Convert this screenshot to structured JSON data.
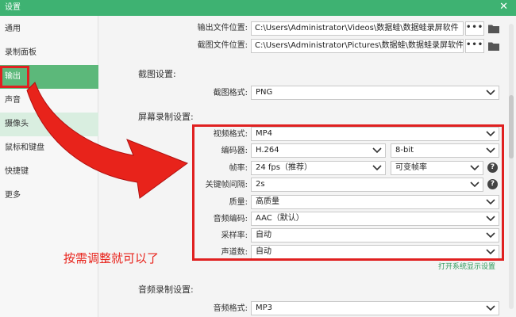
{
  "window": {
    "title": "设置",
    "close_glyph": "✕"
  },
  "sidebar": {
    "items": [
      {
        "label": "通用",
        "state": "normal"
      },
      {
        "label": "录制面板",
        "state": "normal"
      },
      {
        "label": "输出",
        "state": "active"
      },
      {
        "label": "声音",
        "state": "normal"
      },
      {
        "label": "摄像头",
        "state": "hover"
      },
      {
        "label": "鼠标和键盘",
        "state": "normal"
      },
      {
        "label": "快捷键",
        "state": "normal"
      },
      {
        "label": "更多",
        "state": "normal"
      }
    ]
  },
  "output": {
    "output_folder_label": "输出文件位置:",
    "output_folder_value": "C:\\Users\\Administrator\\Videos\\数据蛙\\数据蛙录屏软件",
    "screenshot_folder_label": "截图文件位置:",
    "screenshot_folder_value": "C:\\Users\\Administrator\\Pictures\\数据蛙\\数据蛙录屏软件",
    "browse_label": "•••"
  },
  "screenshot_settings": {
    "section_title": "截图设置:",
    "format_label": "截图格式:",
    "format_value": "PNG"
  },
  "screen_recording": {
    "section_title": "屏幕录制设置:",
    "video_format_label": "视频格式:",
    "video_format_value": "MP4",
    "encoder_label": "编码器:",
    "encoder_value": "H.264",
    "bit_depth_value": "8-bit",
    "framerate_label": "帧率:",
    "framerate_value": "24 fps（推荐）",
    "framerate_mode_value": "可变帧率",
    "keyframe_label": "关键帧间隔:",
    "keyframe_value": "2s",
    "quality_label": "质量:",
    "quality_value": "高质量",
    "audio_codec_label": "音频编码:",
    "audio_codec_value": "AAC（默认）",
    "sample_rate_label": "采样率:",
    "sample_rate_value": "自动",
    "channels_label": "声道数:",
    "channels_value": "自动",
    "help_glyph": "?",
    "system_display_link": "打开系统显示设置"
  },
  "audio_recording": {
    "section_title": "音频录制设置:",
    "format_label": "音频格式:",
    "format_value": "MP3"
  },
  "annotation": {
    "text": "按需调整就可以了",
    "color": "#e8231b"
  },
  "colors": {
    "accent": "#3eb272",
    "active_nav": "#5cb87a",
    "highlight": "#e02020"
  }
}
